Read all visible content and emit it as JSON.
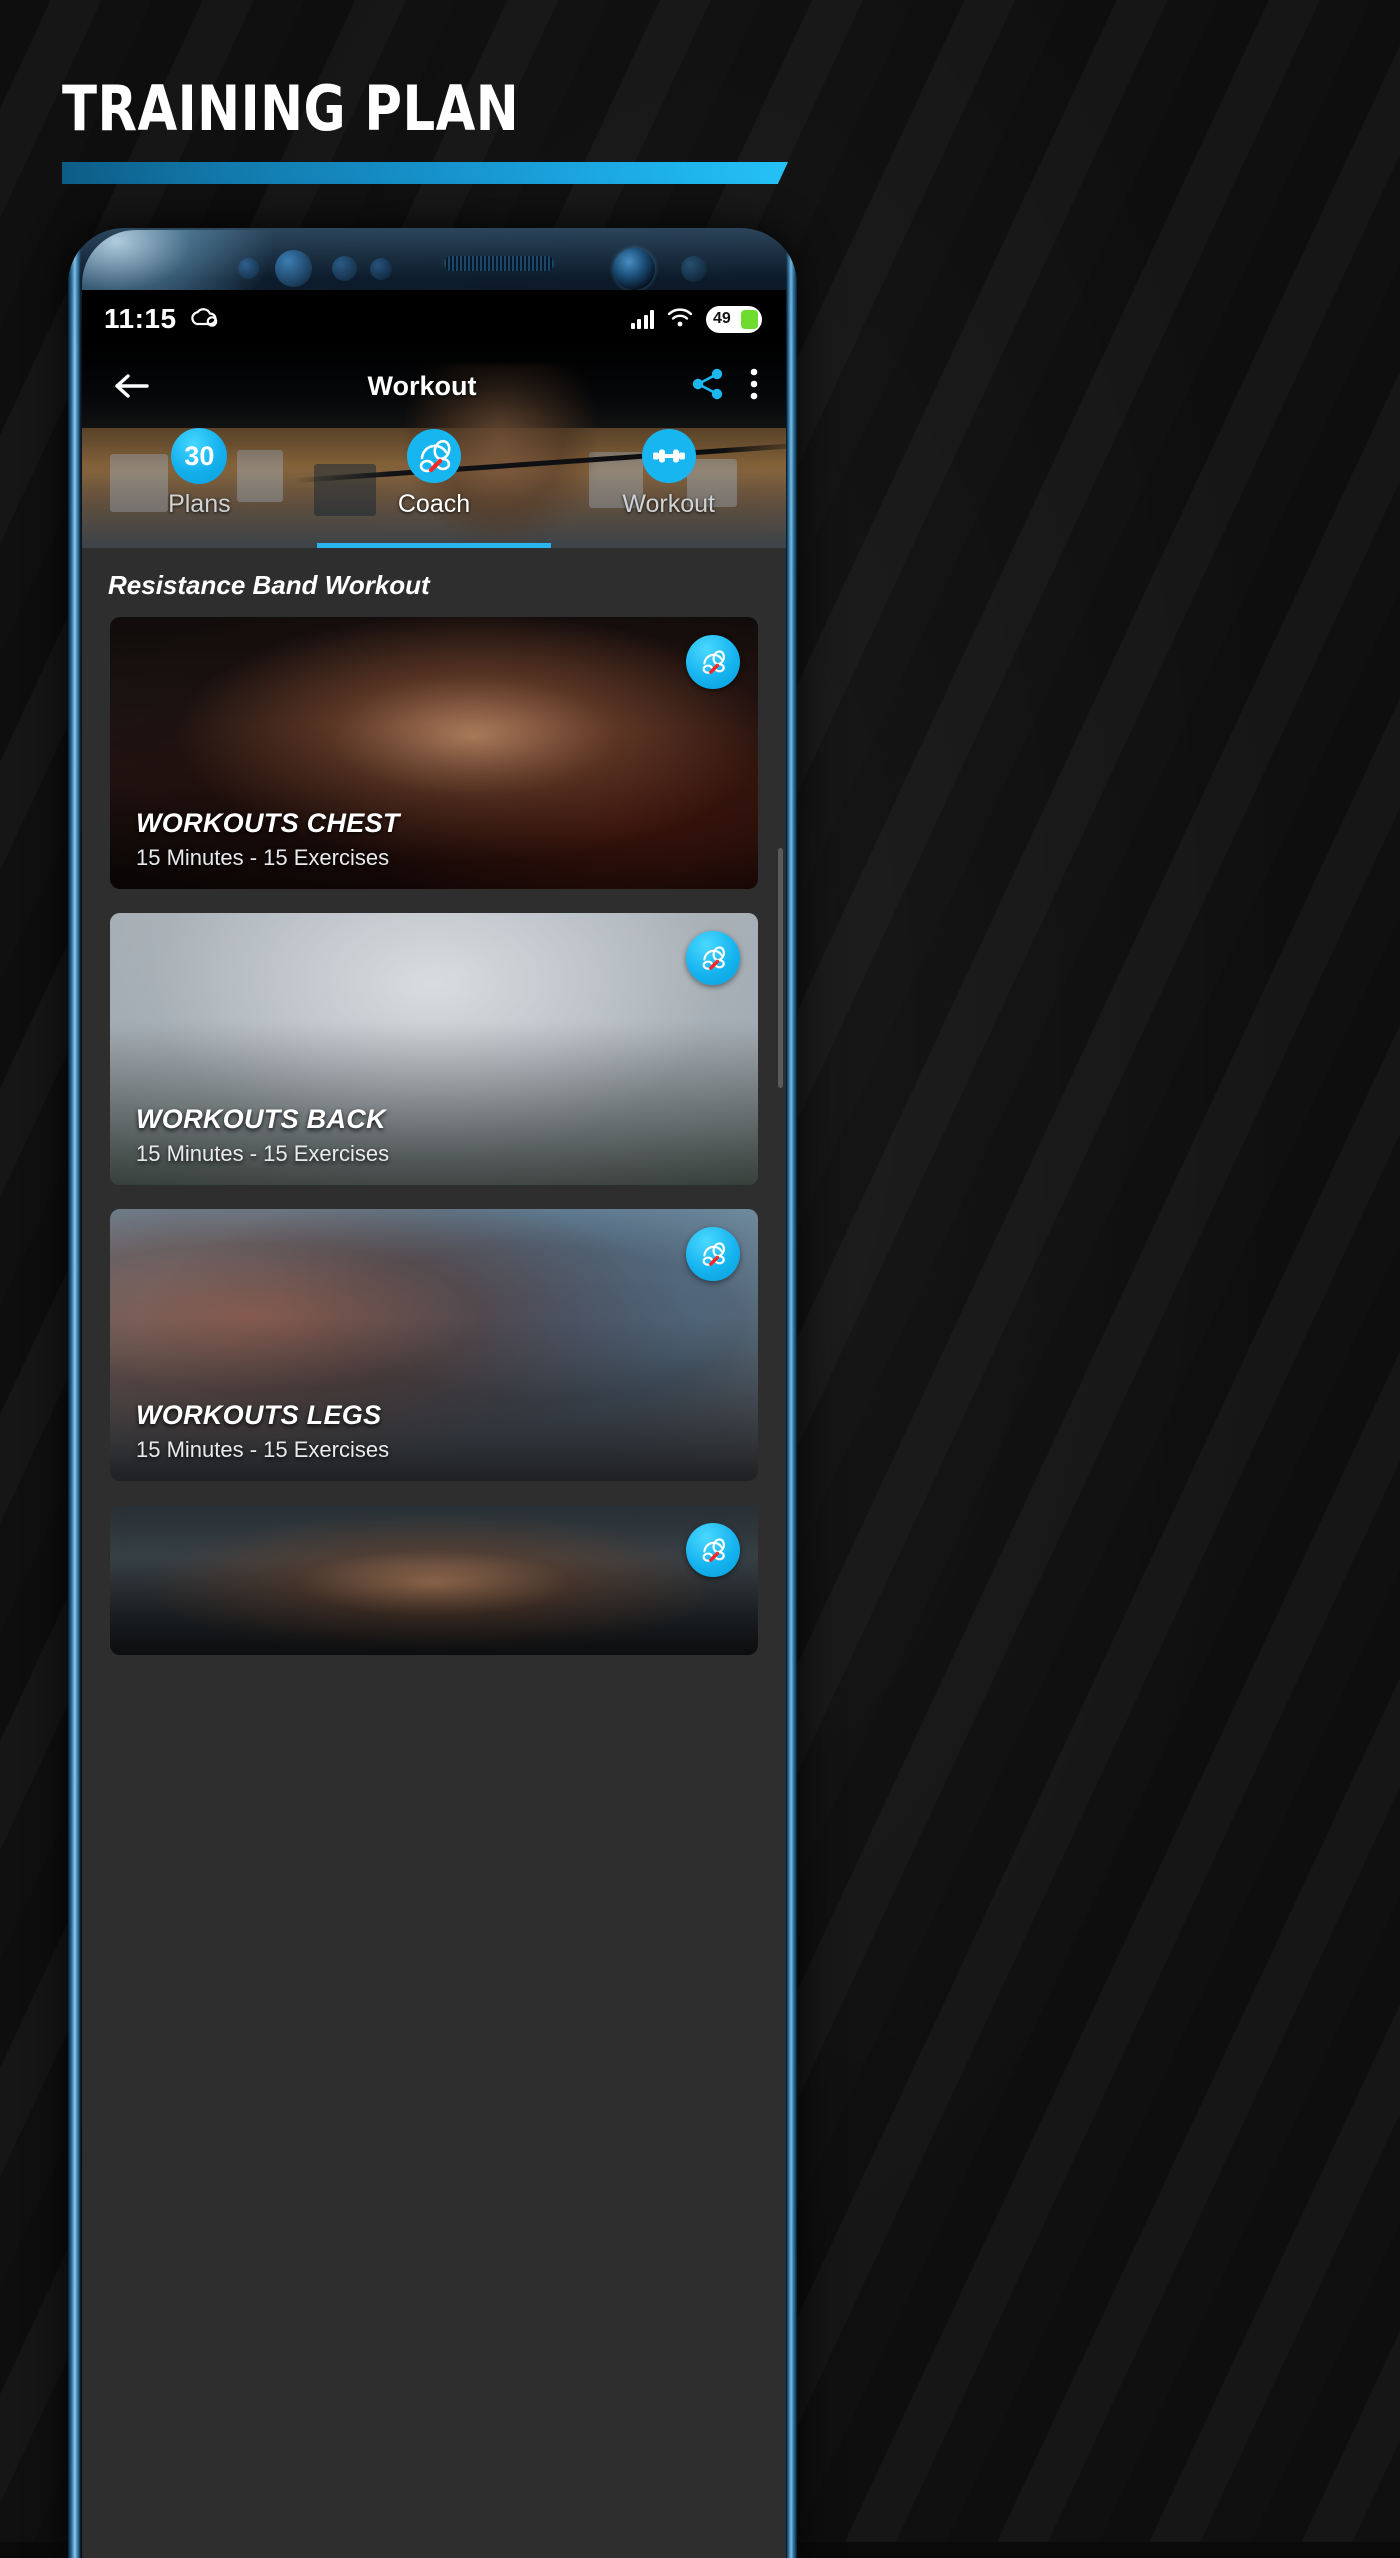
{
  "poster": {
    "headline": "TRAINING PLAN",
    "accent_color": "#1fb4ec",
    "accent_color_dark": "#0d5c86",
    "background_color": "#0e0e0e"
  },
  "phone": {
    "statusbar": {
      "clock": "11:15",
      "cloud_icon": "cloud-icon",
      "signal_icon": "signal-bars-icon",
      "wifi_icon": "wifi-icon",
      "battery_level": "49",
      "battery_icon": "battery-icon"
    },
    "app": {
      "nav": {
        "back_icon": "back-arrow-icon",
        "title": "Workout",
        "share_icon": "share-icon",
        "overflow_icon": "more-vertical-icon"
      },
      "tabs": [
        {
          "label": "Plans",
          "icon": "plans-badge-icon",
          "badge": "30",
          "active": false
        },
        {
          "label": "Coach",
          "icon": "coach-icon",
          "badge": "",
          "active": true
        },
        {
          "label": "Workout",
          "icon": "workout-icon",
          "badge": "",
          "active": false
        }
      ],
      "active_tab_index": 1,
      "accent_color": "#29b6f0",
      "content": {
        "section_title": "Resistance Band Workout",
        "cards": [
          {
            "title": "WORKOUTS CHEST",
            "subtitle": "15 Minutes - 15 Exercises",
            "badge_icon": "coach-icon",
            "image": "man-with-resistance-band-chest"
          },
          {
            "title": "WORKOUTS BACK",
            "subtitle": "15 Minutes - 15 Exercises",
            "badge_icon": "coach-icon",
            "image": "man-with-resistance-band-back"
          },
          {
            "title": "WORKOUTS LEGS",
            "subtitle": "15 Minutes - 15 Exercises",
            "badge_icon": "coach-icon",
            "image": "man-with-resistance-band-legs"
          },
          {
            "title": "",
            "subtitle": "",
            "badge_icon": "coach-icon",
            "image": "man-with-resistance-band-partial"
          }
        ]
      }
    }
  }
}
